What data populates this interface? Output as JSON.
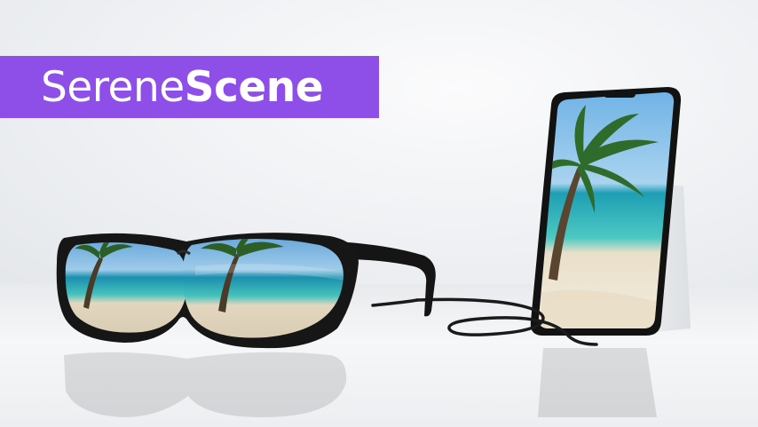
{
  "brand": {
    "name_light": "Serene",
    "name_bold": "Scene",
    "banner_color": "#8e4fe8"
  },
  "objects": {
    "glasses": "glasses-icon",
    "phone": "phone-icon",
    "cable": "cable-icon"
  },
  "colors": {
    "sky": "#7fb9e6",
    "sea": "#2fb6b6",
    "sand": "#efe6d4",
    "frame": "#141414"
  }
}
